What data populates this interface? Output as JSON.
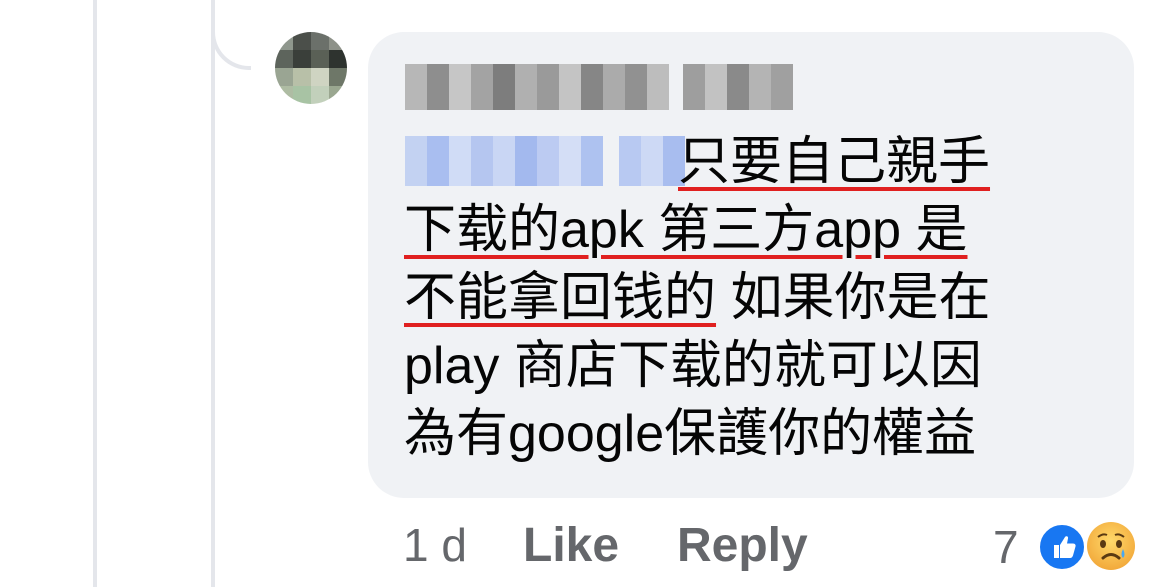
{
  "comment": {
    "author_name": "",
    "mention": "",
    "text_lines": [
      {
        "underlined_part": "只要自己親手",
        "rest": ""
      },
      {
        "underlined_part": "下载的apk 第三方app 是",
        "rest": ""
      },
      {
        "underlined_part": "不能拿回钱的",
        "rest": " 如果你是在"
      },
      {
        "underlined_part": "",
        "rest": "play 商店下载的就可以因"
      },
      {
        "underlined_part": "",
        "rest": "為有google保護你的權益"
      }
    ],
    "underline_color": "#e02020",
    "bubble_color": "#f0f2f5"
  },
  "actions": {
    "age": "1 d",
    "like_label": "Like",
    "reply_label": "Reply",
    "reaction_count": "7",
    "reactions": [
      "like-icon",
      "sad-face-icon"
    ]
  },
  "colors": {
    "text": "#050505",
    "secondary_text": "#65676b",
    "like_blue": "#1877f2",
    "thread_line": "#e4e6eb"
  }
}
